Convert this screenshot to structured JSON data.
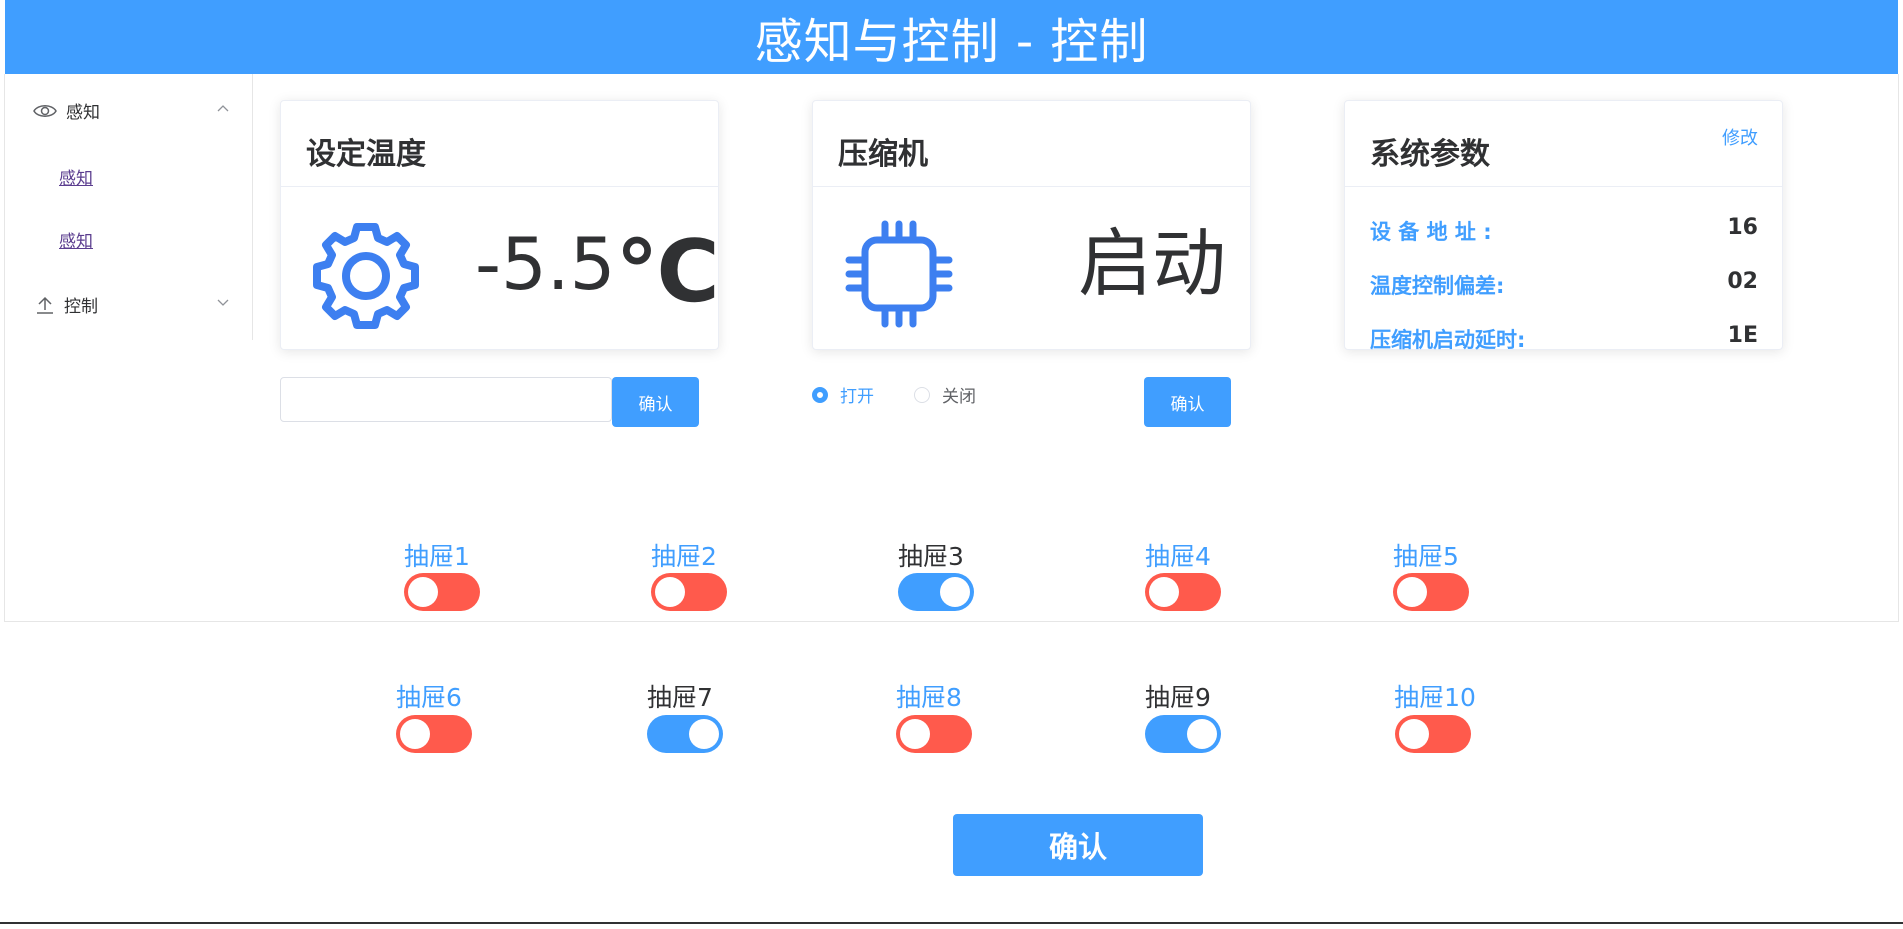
{
  "header": {
    "title": "感知与控制 - 控制"
  },
  "sidebar": {
    "groups": [
      {
        "label": "感知",
        "icon": "eye-icon",
        "items": [
          "感知",
          "感知"
        ]
      },
      {
        "label": "控制",
        "icon": "upload-icon"
      }
    ]
  },
  "temperature_card": {
    "title": "设定温度",
    "value": "-5.5",
    "unit": "℃",
    "icon": "gear-icon",
    "input_value": "",
    "confirm_label": "确认"
  },
  "compressor_card": {
    "title": "压缩机",
    "status": "启动",
    "icon": "chip-icon",
    "options": [
      {
        "label": "打开",
        "checked": true
      },
      {
        "label": "关闭",
        "checked": false
      }
    ],
    "confirm_label": "确认"
  },
  "system_card": {
    "title": "系统参数",
    "edit_label": "修改",
    "params": [
      {
        "label": "设 备 地 址 :",
        "value": "16"
      },
      {
        "label": "温度控制偏差:",
        "value": "02"
      },
      {
        "label": "压缩机启动延时:",
        "value": "1E"
      }
    ]
  },
  "drawers": [
    {
      "label": "抽屉1",
      "on": false
    },
    {
      "label": "抽屉2",
      "on": false
    },
    {
      "label": "抽屉3",
      "on": true
    },
    {
      "label": "抽屉4",
      "on": false
    },
    {
      "label": "抽屉5",
      "on": false
    },
    {
      "label": "抽屉6",
      "on": false
    },
    {
      "label": "抽屉7",
      "on": true
    },
    {
      "label": "抽屉8",
      "on": false
    },
    {
      "label": "抽屉9",
      "on": true
    },
    {
      "label": "抽屉10",
      "on": false
    }
  ],
  "confirm_all_label": "确认",
  "colors": {
    "primary": "#409eff",
    "off": "#ff5a4c",
    "text_dark": "#303133",
    "icon_blue": "#3d7ff0"
  }
}
